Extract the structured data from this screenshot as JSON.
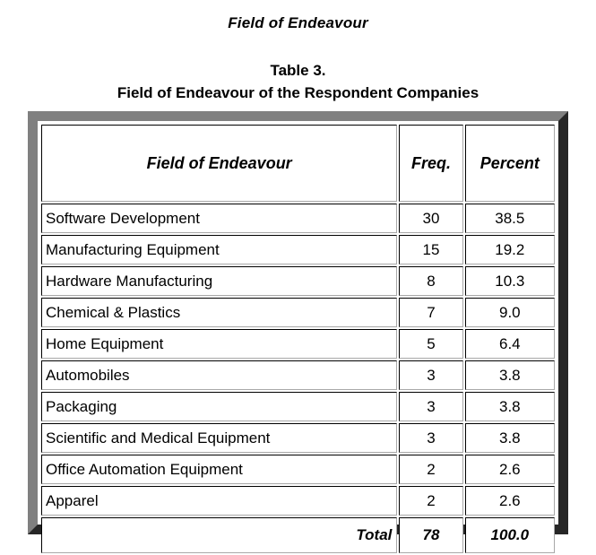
{
  "page": {
    "heading": "Field of Endeavour"
  },
  "caption": {
    "line1": "Table 3.",
    "line2": "Field of Endeavour of the Respondent Companies"
  },
  "table": {
    "columns": [
      "Field of Endeavour",
      "Freq.",
      "Percent"
    ],
    "rows": [
      {
        "label": "Software Development",
        "freq": "30",
        "percent": "38.5"
      },
      {
        "label": "Manufacturing Equipment",
        "freq": "15",
        "percent": "19.2"
      },
      {
        "label": "Hardware Manufacturing",
        "freq": "8",
        "percent": "10.3"
      },
      {
        "label": "Chemical & Plastics",
        "freq": "7",
        "percent": "9.0"
      },
      {
        "label": "Home Equipment",
        "freq": "5",
        "percent": "6.4"
      },
      {
        "label": "Automobiles",
        "freq": "3",
        "percent": "3.8"
      },
      {
        "label": "Packaging",
        "freq": "3",
        "percent": "3.8"
      },
      {
        "label": "Scientific and Medical Equipment",
        "freq": "3",
        "percent": "3.8"
      },
      {
        "label": "Office Automation Equipment",
        "freq": "2",
        "percent": "2.6"
      },
      {
        "label": "Apparel",
        "freq": "2",
        "percent": "2.6"
      }
    ],
    "total": {
      "label": "Total",
      "freq": "78",
      "percent": "100.0"
    }
  },
  "colors": {
    "frame_light": "#808080",
    "frame_dark": "#262626",
    "cell_border_dark": "#000000",
    "cell_border_light": "#a8a8a8",
    "text": "#000000",
    "background": "#ffffff"
  }
}
